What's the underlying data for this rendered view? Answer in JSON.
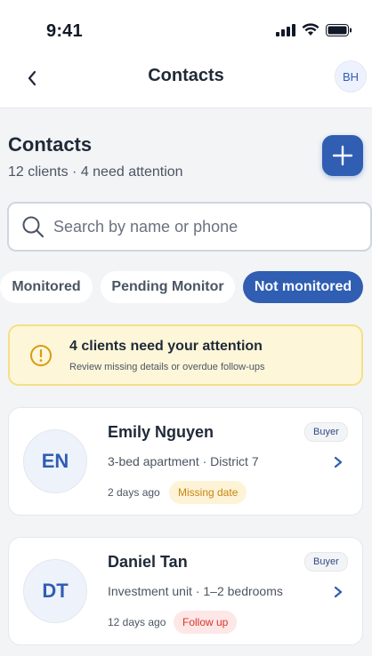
{
  "status_bar": {
    "time": "9:41",
    "icons": [
      "signal-icon",
      "wifi-icon",
      "battery-icon"
    ]
  },
  "nav": {
    "back_icon": "chevron-left-icon",
    "title": "Contacts",
    "avatar_initials": "BH"
  },
  "header": {
    "title": "Contacts",
    "subtitle": "12 clients · 4 need attention",
    "add_icon": "plus-icon"
  },
  "search": {
    "placeholder": "Search by name or phone",
    "value": "",
    "icon": "search-icon"
  },
  "filters": {
    "items": [
      "Monitored",
      "Pending Monitor",
      "Not monitored"
    ],
    "active": "Not monitored"
  },
  "alert": {
    "icon": "warning-circle-icon",
    "title": "4 clients need your attention",
    "description": "Review missing details or overdue follow-ups"
  },
  "contacts": [
    {
      "initials": "EN",
      "name": "Emily Nguyen",
      "detail": "3-bed apartment · District 7",
      "time": "2 days ago",
      "badge": "Missing date",
      "tag": "Buyer"
    },
    {
      "initials": "DT",
      "name": "Daniel Tan",
      "detail": "Investment unit · 1–2 bedrooms",
      "time": "12 days ago",
      "badge": "Follow up",
      "tag": "Buyer"
    }
  ],
  "colors": {
    "accent": "#2f5eb3",
    "warning_bg": "#fdf6d8",
    "warning_border": "#f5df86",
    "amber": "#c98512",
    "red": "#d9342b"
  }
}
